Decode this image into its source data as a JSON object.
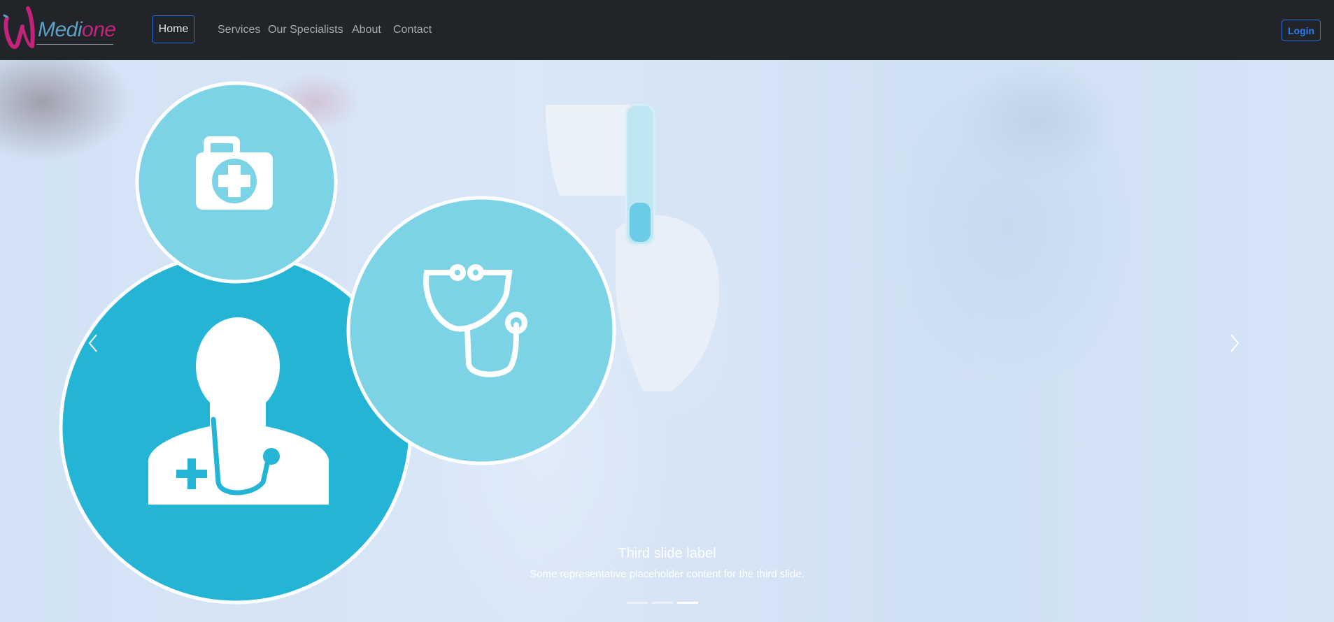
{
  "brand": {
    "name_part1": "Medi",
    "name_part2": "one",
    "logo_icon": "medione-logo-icon"
  },
  "nav": {
    "home": "Home",
    "links": [
      "Services",
      "Our Specialists",
      "About",
      "Contact"
    ],
    "login": "Login"
  },
  "carousel": {
    "caption_title": "Third slide label",
    "caption_text": "Some representative placeholder content for the third slide.",
    "slide_count": 3,
    "active_slide": 3,
    "prev_icon": "chevron-left-icon",
    "next_icon": "chevron-right-icon"
  },
  "colors": {
    "navbar_bg": "#212529",
    "accent_blue": "#2f6fd6",
    "brand_magenta": "#c2247a",
    "circle_dark": "#23b4d6",
    "circle_light": "#7dd3e6"
  },
  "icons": [
    "first-aid-kit-icon",
    "stethoscope-icon",
    "doctor-icon"
  ]
}
